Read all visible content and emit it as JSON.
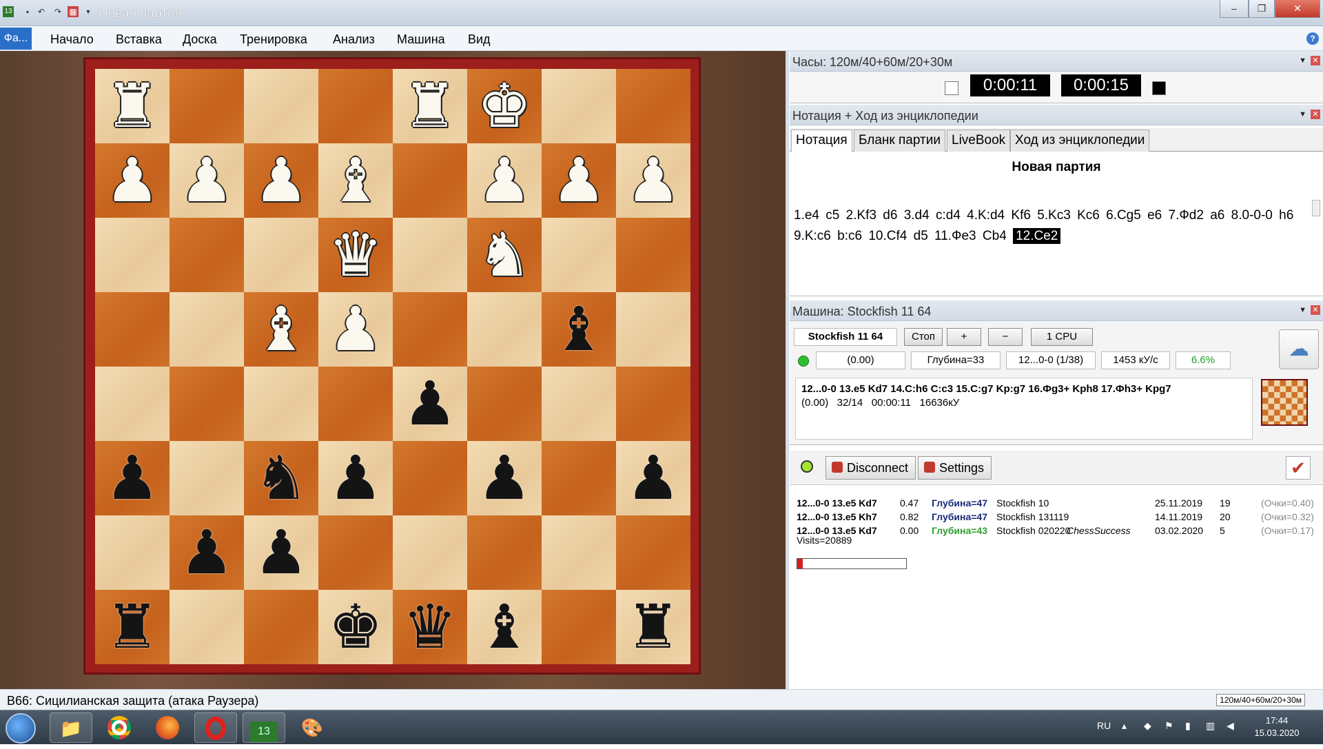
{
  "window": {
    "title": "Новая партия",
    "qa_icons": [
      "chessbase-icon",
      "save-icon",
      "undo-icon",
      "redo-icon",
      "engine-icon",
      "dropdown-icon"
    ]
  },
  "menu": {
    "file": "Фа...",
    "items": [
      "Начало",
      "Вставка",
      "Доска",
      "Тренировка",
      "Анализ",
      "Машина",
      "Вид"
    ]
  },
  "board": {
    "ranks": [
      [
        "wR",
        "",
        "",
        "",
        "wR",
        "wK",
        "",
        ""
      ],
      [
        "wP",
        "wP",
        "wP",
        "wB",
        "",
        "wP",
        "wP",
        "wP"
      ],
      [
        "",
        "",
        "",
        "wQ",
        "",
        "wN",
        "",
        ""
      ],
      [
        "",
        "",
        "wB",
        "wP",
        "",
        "",
        "bB",
        ""
      ],
      [
        "",
        "",
        "",
        "",
        "bP",
        "",
        "",
        ""
      ],
      [
        "bP",
        "",
        "bN",
        "bP",
        "",
        "bP",
        "",
        "bP"
      ],
      [
        "",
        "bP",
        "bP",
        "",
        "",
        "",
        "",
        ""
      ],
      [
        "bR",
        "",
        "",
        "bK",
        "bQ",
        "bB",
        "",
        "bR"
      ]
    ]
  },
  "clock_panel": {
    "title": "Часы: 120м/40+60м/20+30м",
    "white_time": "0:00:11",
    "black_time": "0:00:15"
  },
  "notation_panel": {
    "title": "Нотация + Ход из энциклопедии",
    "tabs": [
      "Нотация",
      "Бланк партии",
      "LiveBook",
      "Ход из энциклопедии"
    ],
    "game_title": "Новая партия",
    "moves": [
      "1.e4",
      "c5",
      "2.Kf3",
      "d6",
      "3.d4",
      "c:d4",
      "4.K:d4",
      "Kf6",
      "5.Kc3",
      "Kc6",
      "6.Cg5",
      "e6",
      "7.Фd2",
      "a6",
      "8.0-0-0",
      "h6",
      "9.K:c6",
      "b:c6",
      "10.Cf4",
      "d5",
      "11.Фe3",
      "Cb4"
    ],
    "current_move": "12.Ce2"
  },
  "engine_panel": {
    "title": "Машина: Stockfish 11 64",
    "engine_name": "Stockfish 11 64",
    "stop": "Стоп",
    "plus": "+",
    "minus": "−",
    "cpu": "1 CPU",
    "eval": "(0.00)",
    "depth": "Глубина=33",
    "current": "12...0-0 (1/38)",
    "speed": "1453 кУ/с",
    "tb": "6.6%",
    "pv_line": "12...0-0 13.e5 Kd7 14.C:h6 C:c3 15.C:g7 Kp:g7 16.Фg3+ Kph8 17.Фh3+ Kpg7",
    "pv_stats": "(0.00)   32/14   00:00:11   16636кУ"
  },
  "cloud_panel": {
    "disconnect": "Disconnect",
    "settings": "Settings",
    "rows": [
      {
        "line": "12...0-0 13.e5 Kd7",
        "eval": "0.47",
        "depth": "Глубина=47",
        "engine": "Stockfish 10",
        "user": "",
        "date": "25.11.2019",
        "n": "19",
        "score": "(Очки=0.40)",
        "depth_color": "#1a2a7a"
      },
      {
        "line": "12...0-0 13.e5 Kh7",
        "eval": "0.82",
        "depth": "Глубина=47",
        "engine": "Stockfish 131119",
        "user": "",
        "date": "14.11.2019",
        "n": "20",
        "score": "(Очки=0.32)",
        "depth_color": "#1a2a7a"
      },
      {
        "line": "12...0-0 13.e5 Kd7",
        "eval": "0.00",
        "depth": "Глубина=43",
        "engine": "Stockfish 020220",
        "user": "ChessSuccess",
        "date": "03.02.2020",
        "n": "5",
        "score": "(Очки=0.17)",
        "depth_color": "#2e9e2e"
      }
    ],
    "visits": "Visits=20889",
    "progress": 0.05
  },
  "statusbar": {
    "opening": "B66: Сицилианская защита (атака Раузера)",
    "time_control": "120м/40+60м/20+30м"
  },
  "taskbar": {
    "lang": "RU",
    "time": "17:44",
    "date": "15.03.2020",
    "apps": [
      "explorer-icon",
      "chrome-icon",
      "firefox-icon",
      "opera-icon",
      "chessbase-icon",
      "paint-icon"
    ]
  }
}
